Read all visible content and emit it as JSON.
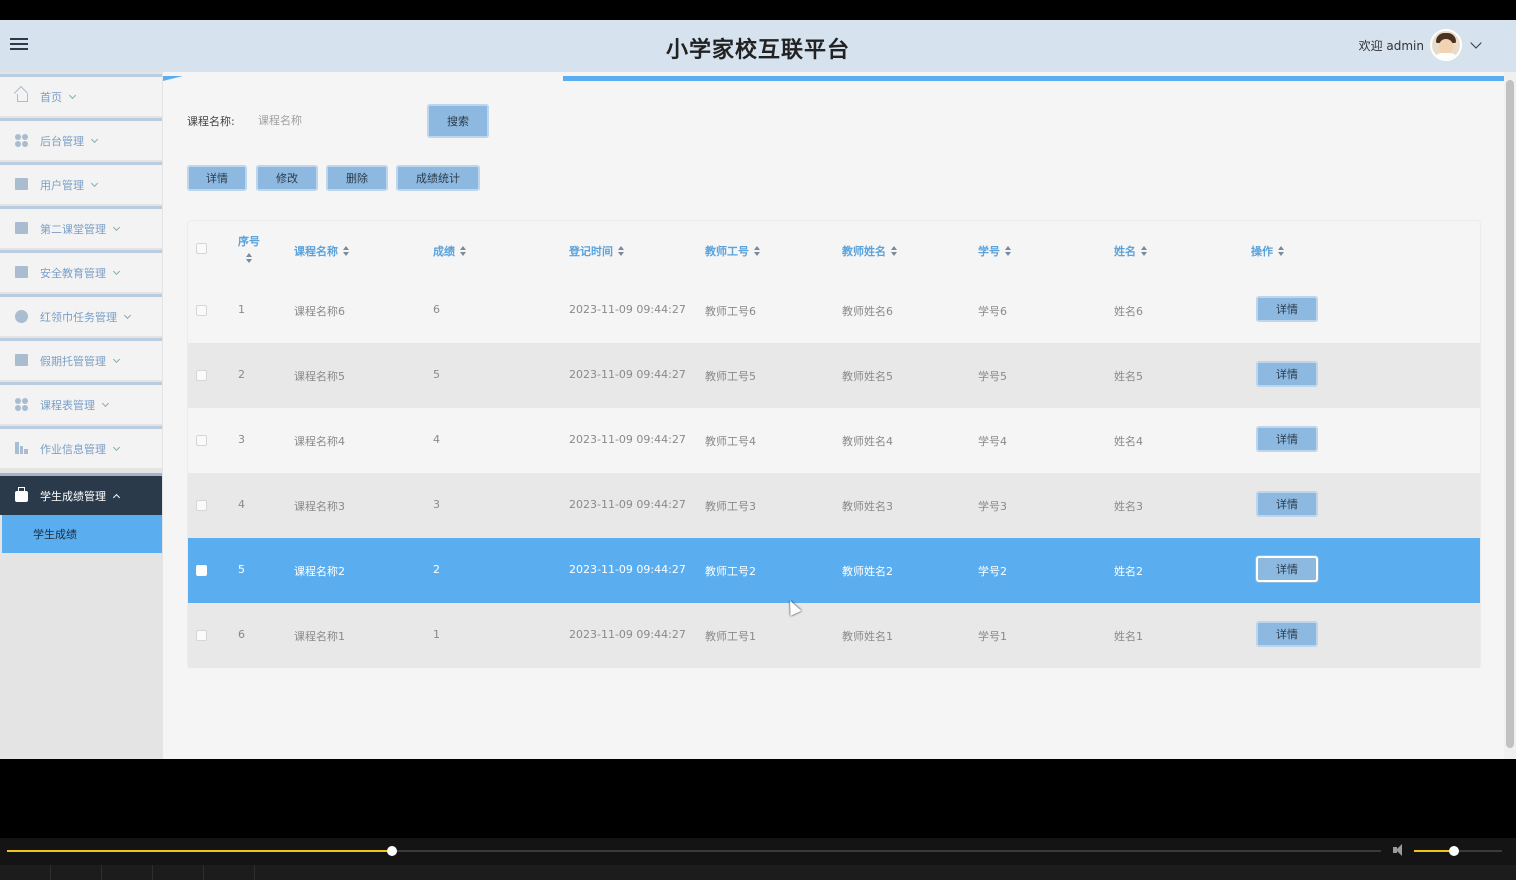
{
  "header": {
    "title": "小学家校互联平台",
    "welcome": "欢迎 admin"
  },
  "sidebar": {
    "items": [
      {
        "label": "首页",
        "icon": "home-icon"
      },
      {
        "label": "后台管理",
        "icon": "grid-icon"
      },
      {
        "label": "用户管理",
        "icon": "book-icon"
      },
      {
        "label": "第二课堂管理",
        "icon": "stack-icon"
      },
      {
        "label": "安全教育管理",
        "icon": "window-icon"
      },
      {
        "label": "红领巾任务管理",
        "icon": "gauge-icon"
      },
      {
        "label": "假期托管管理",
        "icon": "square-icon"
      },
      {
        "label": "课程表管理",
        "icon": "grid-icon"
      },
      {
        "label": "作业信息管理",
        "icon": "bar-chart-icon"
      },
      {
        "label": "学生成绩管理",
        "icon": "briefcase-icon"
      }
    ],
    "active_sub": "学生成绩"
  },
  "search": {
    "label": "课程名称:",
    "placeholder": "课程名称",
    "button": "搜索"
  },
  "toolbar": {
    "detail": "详情",
    "edit": "修改",
    "delete": "删除",
    "stats": "成绩统计"
  },
  "table": {
    "columns": [
      "序号",
      "课程名称",
      "成绩",
      "登记时间",
      "教师工号",
      "教师姓名",
      "学号",
      "姓名",
      "操作"
    ],
    "action_label": "详情",
    "rows": [
      {
        "no": "1",
        "course": "课程名称6",
        "score": "6",
        "time": "2023-11-09 09:44:27",
        "teacher_id": "教师工号6",
        "teacher_name": "教师姓名6",
        "student_id": "学号6",
        "name": "姓名6"
      },
      {
        "no": "2",
        "course": "课程名称5",
        "score": "5",
        "time": "2023-11-09 09:44:27",
        "teacher_id": "教师工号5",
        "teacher_name": "教师姓名5",
        "student_id": "学号5",
        "name": "姓名5"
      },
      {
        "no": "3",
        "course": "课程名称4",
        "score": "4",
        "time": "2023-11-09 09:44:27",
        "teacher_id": "教师工号4",
        "teacher_name": "教师姓名4",
        "student_id": "学号4",
        "name": "姓名4"
      },
      {
        "no": "4",
        "course": "课程名称3",
        "score": "3",
        "time": "2023-11-09 09:44:27",
        "teacher_id": "教师工号3",
        "teacher_name": "教师姓名3",
        "student_id": "学号3",
        "name": "姓名3"
      },
      {
        "no": "5",
        "course": "课程名称2",
        "score": "2",
        "time": "2023-11-09 09:44:27",
        "teacher_id": "教师工号2",
        "teacher_name": "教师姓名2",
        "student_id": "学号2",
        "name": "姓名2"
      },
      {
        "no": "6",
        "course": "课程名称1",
        "score": "1",
        "time": "2023-11-09 09:44:27",
        "teacher_id": "教师工号1",
        "teacher_name": "教师姓名1",
        "student_id": "学号1",
        "name": "姓名1"
      }
    ],
    "selected_row": 5
  },
  "player": {
    "progress": 0.28,
    "volume": 0.45
  },
  "colors": {
    "accent": "#5aaef0",
    "header_bg": "#d6e2ee",
    "sidebar_active": "#2b3a4a",
    "button": "#8db8df",
    "column_header": "#5ba3dc",
    "seek": "#f0c419"
  }
}
